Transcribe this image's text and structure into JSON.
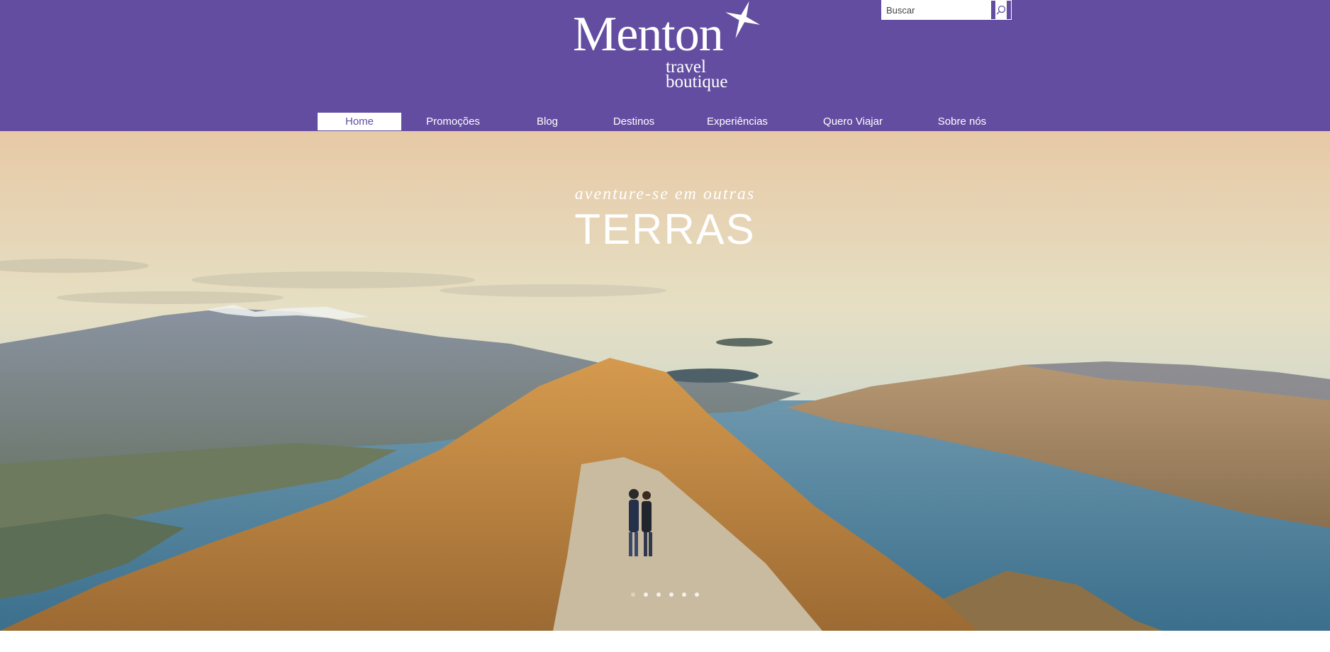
{
  "brand": {
    "name": "Menton",
    "tagline_line1": "travel",
    "tagline_line2": "boutique",
    "logo_icon": "compass-star-icon"
  },
  "search": {
    "placeholder": "Buscar",
    "icon": "search-icon"
  },
  "nav": {
    "items": [
      {
        "label": "Home",
        "active": true
      },
      {
        "label": "Promoções",
        "active": false
      },
      {
        "label": "Blog",
        "active": false
      },
      {
        "label": "Destinos",
        "active": false
      },
      {
        "label": "Experiências",
        "active": false
      },
      {
        "label": "Quero Viajar",
        "active": false
      },
      {
        "label": "Sobre nós",
        "active": false
      }
    ]
  },
  "hero": {
    "tagline": "aventure-se em outras",
    "title": "TERRAS",
    "slides_total": 6,
    "active_slide": 1
  },
  "colors": {
    "header_bg": "#634da0",
    "text_light": "#ffffff"
  }
}
